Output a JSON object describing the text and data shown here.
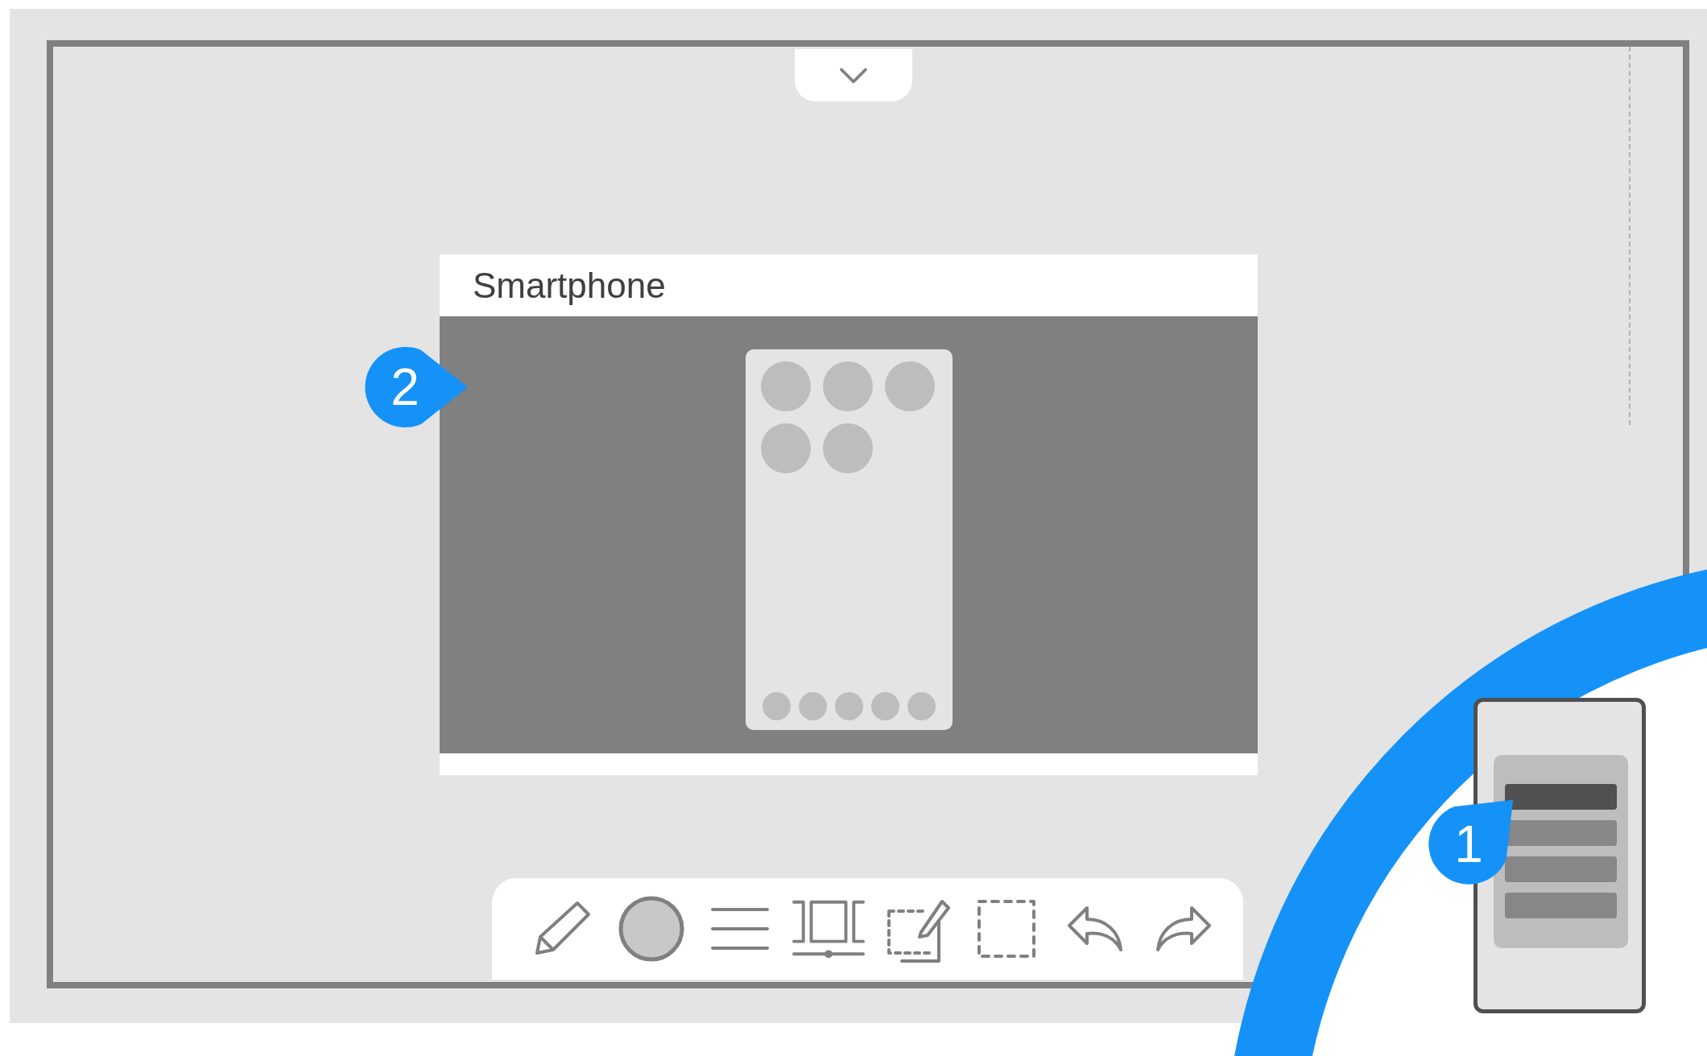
{
  "card": {
    "title": "Smartphone"
  },
  "callouts": [
    {
      "label": "2",
      "kind": "card"
    },
    {
      "label": "1",
      "kind": "panel"
    }
  ],
  "toolbar": {
    "tools": [
      {
        "kind": "pen"
      },
      {
        "kind": "color"
      },
      {
        "kind": "menu"
      },
      {
        "kind": "fit"
      },
      {
        "kind": "edit-selection"
      },
      {
        "kind": "select"
      },
      {
        "kind": "undo"
      },
      {
        "kind": "redo"
      }
    ]
  },
  "mini_panel": {
    "items": [
      {
        "selected": true
      },
      {
        "selected": false
      },
      {
        "selected": false
      },
      {
        "selected": false
      }
    ]
  }
}
